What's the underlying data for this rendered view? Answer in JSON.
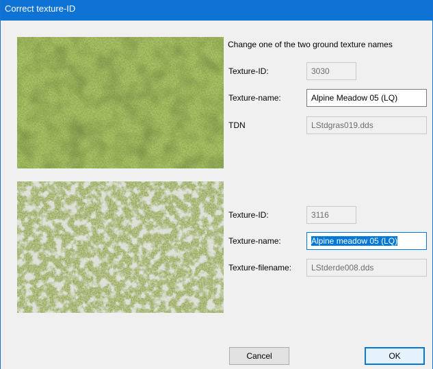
{
  "window": {
    "title": "Correct texture-ID"
  },
  "instruction": "Change one of the two ground texture names",
  "texture1": {
    "image_icon": "grass-texture",
    "id_label": "Texture-ID:",
    "id_value": "3030",
    "name_label": "Texture-name:",
    "name_value": "Alpine Meadow 05 (LQ)",
    "file_label": "TDN",
    "file_value": "LStdgras019.dds"
  },
  "texture2": {
    "image_icon": "rocky-grass-texture",
    "id_label": "Texture-ID:",
    "id_value": "3116",
    "name_label": "Texture-name:",
    "name_value": "Alpine meadow 05 (LQ)",
    "file_label": "Texture-filename:",
    "file_value": "LStderde008.dds"
  },
  "buttons": {
    "cancel": "Cancel",
    "ok": "OK"
  },
  "colors": {
    "titlebar": "#0f73d6",
    "focus": "#0078d7",
    "dialog_bg": "#f0f0f0"
  }
}
